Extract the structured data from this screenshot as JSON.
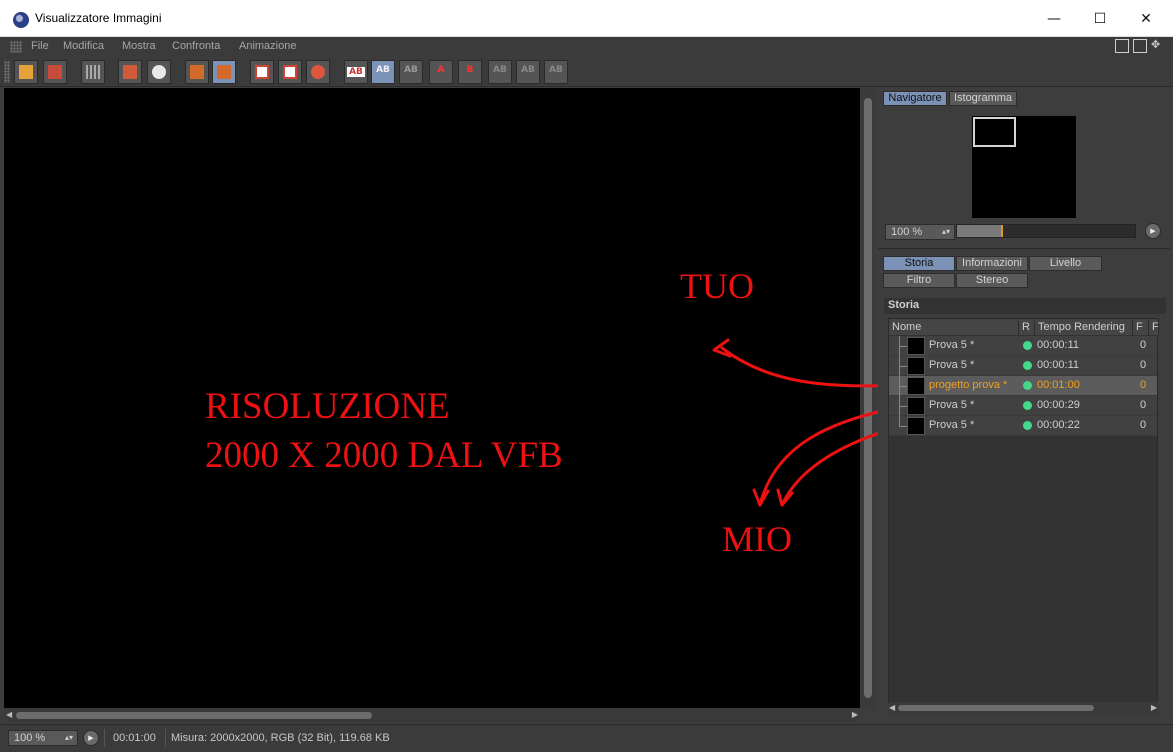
{
  "window": {
    "title": "Visualizzatore Immagini",
    "minimize_icon": "—",
    "maximize_icon": "☐",
    "close_icon": "✕"
  },
  "menu": [
    "File",
    "Modifica",
    "Mostra",
    "Confronta",
    "Animazione"
  ],
  "toolbar": {
    "icons": [
      "open-icon",
      "save-icon",
      "grid-icon",
      "transfer-icon",
      "search-icon",
      "layers-icon",
      "layers-list-icon",
      "frame-icon",
      "frame-eye-icon",
      "frame-gear-icon",
      "ab-icon",
      "ab-split-icon",
      "ab-overlay-icon",
      "set-a-icon",
      "set-b-icon",
      "ab-compare-icon",
      "ab-grid-icon",
      "ab-text-icon"
    ],
    "ab_label": "AB",
    "a_label": "A",
    "b_label": "B"
  },
  "annotations": {
    "tuo": "TUO",
    "risoluzione_line1": "RISOLUZIONE",
    "risoluzione_line2": "2000 X 2000 DAL VFB",
    "mio": "MIO",
    "color": "#ee1111"
  },
  "right_panel": {
    "top_tabs": [
      "Navigatore",
      "Istogramma"
    ],
    "zoom": "100 %",
    "info_tabs": [
      "Storia",
      "Informazioni",
      "Livello",
      "Filtro",
      "Stereo"
    ],
    "section_title": "Storia",
    "columns": [
      "Nome",
      "R",
      "Tempo Rendering",
      "F",
      "F"
    ],
    "rows": [
      {
        "name": "Prova 5 *",
        "time": "00:00:11",
        "f": "0",
        "selected": false
      },
      {
        "name": "Prova 5 *",
        "time": "00:00:11",
        "f": "0",
        "selected": false
      },
      {
        "name": "progetto prova *",
        "time": "00:01:00",
        "f": "0",
        "selected": true
      },
      {
        "name": "Prova 5 *",
        "time": "00:00:29",
        "f": "0",
        "selected": false
      },
      {
        "name": "Prova 5 *",
        "time": "00:00:22",
        "f": "0",
        "selected": false
      }
    ],
    "status_dot_color": "#46d78b",
    "selected_text_color": "#f0a020"
  },
  "status": {
    "zoom": "100 %",
    "time": "00:01:00",
    "info": "Misura: 2000x2000, RGB (32 Bit), 119.68 KB"
  }
}
